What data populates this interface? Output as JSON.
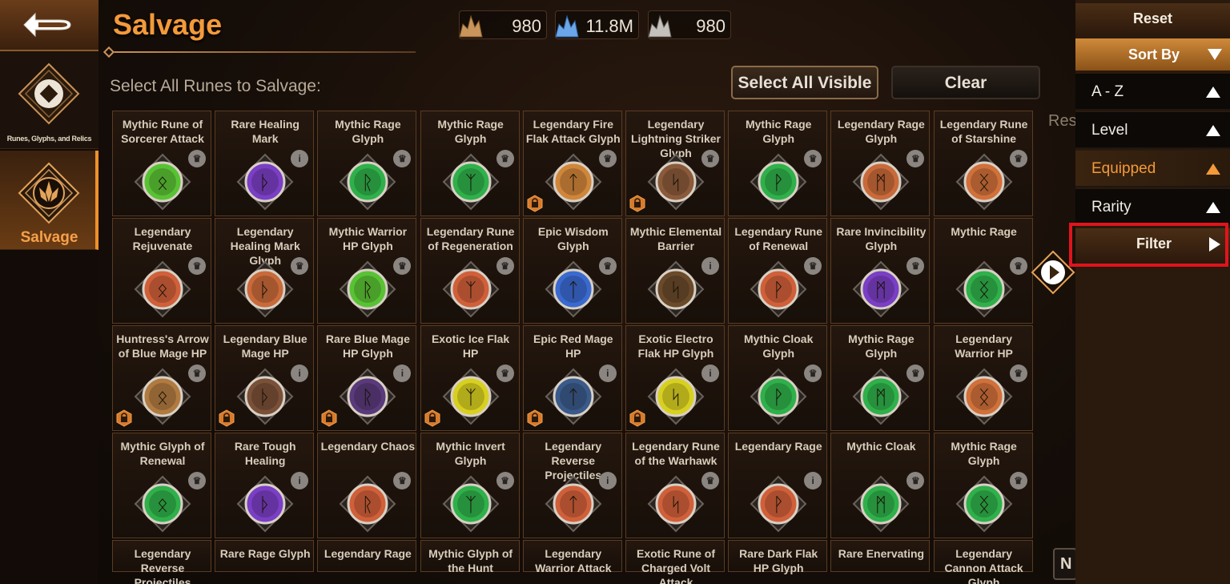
{
  "rail": {
    "tabs": [
      {
        "label": "Runes, Glyphs, and Relics"
      },
      {
        "label": "Salvage"
      }
    ]
  },
  "header": {
    "title": "Salvage",
    "currencies": [
      {
        "icon": "gold-crystal-icon",
        "value": "980"
      },
      {
        "icon": "blue-crystal-icon",
        "value": "11.8M"
      },
      {
        "icon": "silver-crystal-icon",
        "value": "980"
      }
    ]
  },
  "toolbar": {
    "prompt": "Select All Runes to Salvage:",
    "select_all_label": "Select All Visible",
    "clear_label": "Clear"
  },
  "grid": {
    "items": [
      {
        "name": "Mythic Rune of Sorcerer Attack",
        "color": "#59c234",
        "badge": "crown",
        "lock": false
      },
      {
        "name": "Rare Healing Mark",
        "color": "#7a3fc4",
        "badge": "i",
        "lock": false
      },
      {
        "name": "Mythic Rage Glyph",
        "color": "#2fb04a",
        "badge": "crown",
        "lock": false
      },
      {
        "name": "Mythic Rage Glyph",
        "color": "#2fb04a",
        "badge": "crown",
        "lock": false
      },
      {
        "name": "Legendary Fire Flak Attack Glyph",
        "color": "#d0863a",
        "badge": "crown",
        "lock": true
      },
      {
        "name": "Legendary Lightning Striker Glyph",
        "color": "#8a5a3a",
        "badge": "crown",
        "lock": true
      },
      {
        "name": "Mythic Rage Glyph",
        "color": "#2fb04a",
        "badge": "crown",
        "lock": false
      },
      {
        "name": "Legendary Rage Glyph",
        "color": "#c96a3a",
        "badge": "crown",
        "lock": false
      },
      {
        "name": "Legendary Rune of Starshine",
        "color": "#d0703a",
        "badge": "crown",
        "lock": false
      },
      {
        "name": "Legendary Rejuvenate",
        "color": "#d0603a",
        "badge": "crown",
        "lock": false
      },
      {
        "name": "Legendary Healing Mark Glyph",
        "color": "#c96a3a",
        "badge": "crown",
        "lock": false
      },
      {
        "name": "Mythic Warrior HP Glyph",
        "color": "#59c234",
        "badge": "crown",
        "lock": false
      },
      {
        "name": "Legendary Rune of Regeneration",
        "color": "#d0603a",
        "badge": "crown",
        "lock": false
      },
      {
        "name": "Epic Wisdom Glyph",
        "color": "#3a6ad0",
        "badge": "crown",
        "lock": false
      },
      {
        "name": "Mythic Elemental Barrier",
        "color": "#6a4a2a",
        "badge": "i",
        "lock": false
      },
      {
        "name": "Legendary Rune of Renewal",
        "color": "#d0603a",
        "badge": "crown",
        "lock": false
      },
      {
        "name": "Rare Invincibility Glyph",
        "color": "#7a3fc4",
        "badge": "crown",
        "lock": false
      },
      {
        "name": "Mythic Rage",
        "color": "#2fb04a",
        "badge": "crown",
        "lock": false
      },
      {
        "name": "Huntress's Arrow of Blue Mage HP",
        "color": "#b07a40",
        "badge": "crown",
        "lock": true
      },
      {
        "name": "Legendary Blue Mage HP",
        "color": "#7a5038",
        "badge": "i",
        "lock": true
      },
      {
        "name": "Rare Blue Mage HP Glyph",
        "color": "#5a3a7a",
        "badge": "i",
        "lock": true
      },
      {
        "name": "Exotic Ice Flak HP",
        "color": "#d8d020",
        "badge": "crown",
        "lock": true
      },
      {
        "name": "Epic Red Mage HP",
        "color": "#3a5a8a",
        "badge": "i",
        "lock": true
      },
      {
        "name": "Exotic Electro Flak HP Glyph",
        "color": "#d8d020",
        "badge": "i",
        "lock": true
      },
      {
        "name": "Mythic Cloak Glyph",
        "color": "#2fb04a",
        "badge": "crown",
        "lock": false
      },
      {
        "name": "Mythic Rage Glyph",
        "color": "#2fb04a",
        "badge": "crown",
        "lock": false
      },
      {
        "name": "Legendary Warrior HP",
        "color": "#d0703a",
        "badge": "crown",
        "lock": false
      },
      {
        "name": "Mythic Glyph of Renewal",
        "color": "#2fb04a",
        "badge": "crown",
        "lock": false
      },
      {
        "name": "Rare Tough Healing",
        "color": "#7a3fc4",
        "badge": "i",
        "lock": false
      },
      {
        "name": "Legendary Chaos",
        "color": "#d0603a",
        "badge": "crown",
        "lock": false
      },
      {
        "name": "Mythic Invert Glyph",
        "color": "#2fb04a",
        "badge": "crown",
        "lock": false
      },
      {
        "name": "Legendary Reverse Projectiles",
        "color": "#d0603a",
        "badge": "i",
        "lock": false
      },
      {
        "name": "Legendary Rune of the Warhawk",
        "color": "#d0603a",
        "badge": "crown",
        "lock": false
      },
      {
        "name": "Legendary Rage",
        "color": "#d0603a",
        "badge": "i",
        "lock": false
      },
      {
        "name": "Mythic Cloak",
        "color": "#2fb04a",
        "badge": "crown",
        "lock": false
      },
      {
        "name": "Mythic Rage Glyph",
        "color": "#2fb04a",
        "badge": "crown",
        "lock": false
      },
      {
        "name": "Legendary Reverse Projectiles",
        "color": "#d0603a",
        "badge": "",
        "lock": false
      },
      {
        "name": "Rare Rage Glyph",
        "color": "#7a3fc4",
        "badge": "",
        "lock": false
      },
      {
        "name": "Legendary Rage",
        "color": "#d0603a",
        "badge": "",
        "lock": false
      },
      {
        "name": "Mythic Glyph of the Hunt",
        "color": "#2fb04a",
        "badge": "",
        "lock": false
      },
      {
        "name": "Legendary Warrior Attack",
        "color": "#d0603a",
        "badge": "",
        "lock": false
      },
      {
        "name": "Exotic Rune of Charged Volt Attack",
        "color": "#d8d020",
        "badge": "",
        "lock": false
      },
      {
        "name": "Rare Dark Flak HP Glyph",
        "color": "#7a3fc4",
        "badge": "",
        "lock": false
      },
      {
        "name": "Rare Enervating",
        "color": "#7a3fc4",
        "badge": "",
        "lock": false
      },
      {
        "name": "Legendary Cannon Attack Glyph",
        "color": "#d0603a",
        "badge": "",
        "lock": false
      }
    ]
  },
  "fragments": {
    "res": "Res",
    "n": "N"
  },
  "side": {
    "reset_label": "Reset",
    "sortby_label": "Sort By",
    "options": [
      {
        "label": "A - Z",
        "active": false
      },
      {
        "label": "Level",
        "active": false
      },
      {
        "label": "Equipped",
        "active": true
      },
      {
        "label": "Rarity",
        "active": false
      }
    ],
    "filter_label": "Filter"
  },
  "colors": {
    "accent": "#f39a3a",
    "highlight": "#e0141c"
  }
}
